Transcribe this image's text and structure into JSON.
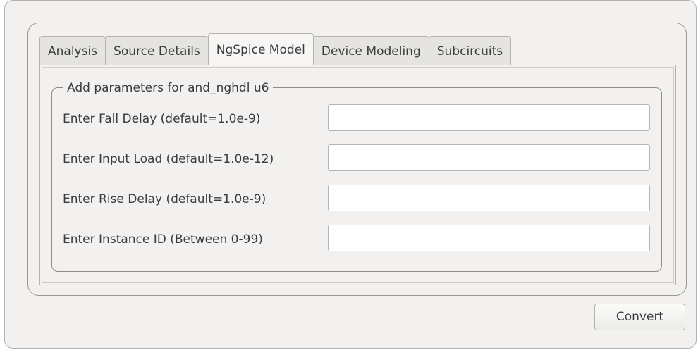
{
  "tabs": [
    {
      "label": "Analysis",
      "active": false
    },
    {
      "label": "Source Details",
      "active": false
    },
    {
      "label": "NgSpice Model",
      "active": true
    },
    {
      "label": "Device Modeling",
      "active": false
    },
    {
      "label": "Subcircuits",
      "active": false
    }
  ],
  "group": {
    "title": "Add parameters for and_nghdl u6"
  },
  "fields": [
    {
      "label": "Enter Fall Delay (default=1.0e-9)",
      "value": ""
    },
    {
      "label": "Enter Input Load (default=1.0e-12)",
      "value": ""
    },
    {
      "label": "Enter Rise Delay (default=1.0e-9)",
      "value": ""
    },
    {
      "label": "Enter Instance ID (Between 0-99)",
      "value": ""
    }
  ],
  "actions": {
    "convert_label": "Convert"
  },
  "colors": {
    "window_bg": "#f2f1f0",
    "border": "#b5b3af",
    "text": "#3c3c3c"
  }
}
